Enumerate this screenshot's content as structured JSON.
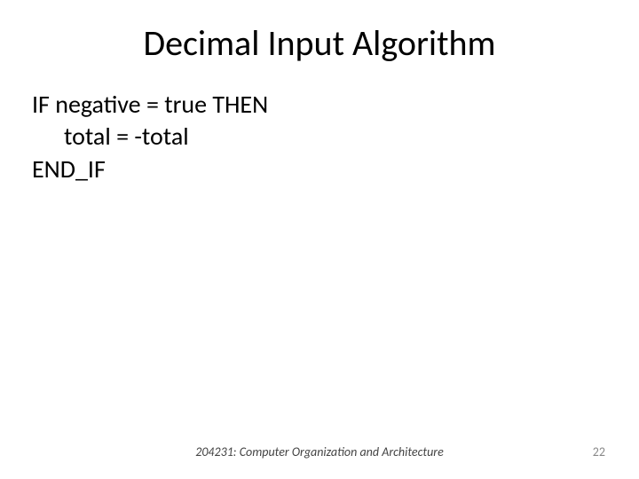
{
  "title": "Decimal Input Algorithm",
  "lines": {
    "l1": "IF  negative = true  THEN",
    "l2": "total = -total",
    "l3": "END_IF"
  },
  "footer": "204231: Computer Organization and Architecture",
  "page_number": "22"
}
